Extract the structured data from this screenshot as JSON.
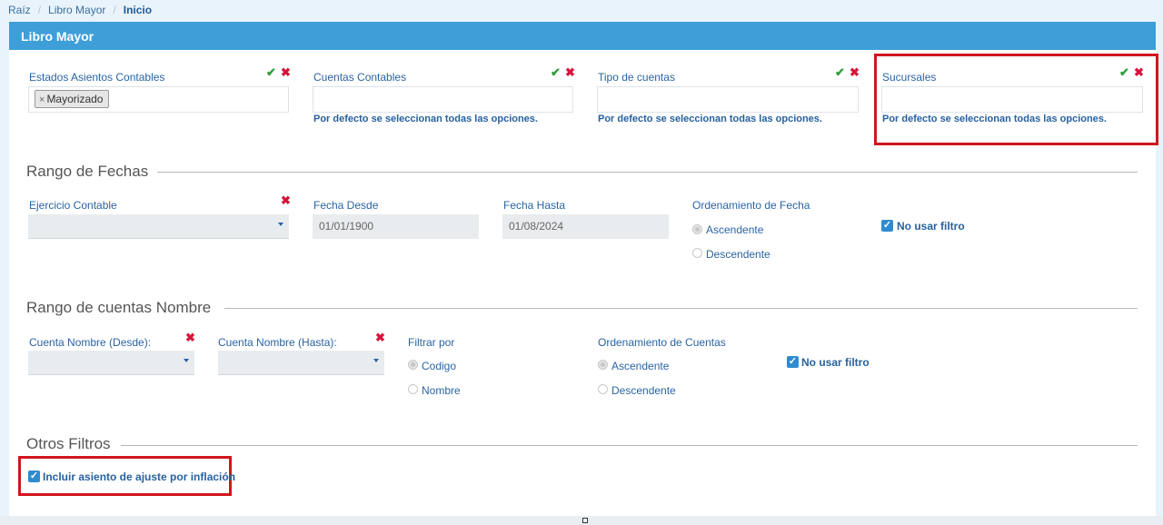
{
  "breadcrumb": {
    "items": [
      "Raíz",
      "Libro Mayor",
      "Inicio"
    ]
  },
  "panel": {
    "title": "Libro Mayor"
  },
  "filters": {
    "estados": {
      "label": "Estados Asientos Contables",
      "tag": "Mayorizado",
      "tag_remove": "×"
    },
    "cuentas": {
      "label": "Cuentas Contables",
      "hint": "Por defecto se seleccionan todas las opciones."
    },
    "tipo": {
      "label": "Tipo de cuentas",
      "hint": "Por defecto se seleccionan todas las opciones."
    },
    "sucursales": {
      "label": "Sucursales",
      "hint": "Por defecto se seleccionan todas las opciones."
    }
  },
  "icons": {
    "check": "✔",
    "close": "✖"
  },
  "fechas": {
    "title": "Rango de Fechas",
    "ejercicio_label": "Ejercicio Contable",
    "desde_label": "Fecha Desde",
    "desde_value": "01/01/1900",
    "hasta_label": "Fecha Hasta",
    "hasta_value": "01/08/2024",
    "orden_label": "Ordenamiento de Fecha",
    "asc": "Ascendente",
    "desc": "Descendente",
    "no_filtro": "No usar filtro"
  },
  "cuentas_nombre": {
    "title": "Rango de cuentas Nombre",
    "desde_label": "Cuenta Nombre (Desde):",
    "hasta_label": "Cuenta Nombre (Hasta):",
    "filtrar_label": "Filtrar por",
    "codigo": "Codigo",
    "nombre": "Nombre",
    "orden_label": "Ordenamiento de Cuentas",
    "asc": "Ascendente",
    "desc": "Descendente",
    "no_filtro": "No usar filtro"
  },
  "otros": {
    "title": "Otros Filtros",
    "ajuste": "Incluir asiento de ajuste por inflación"
  },
  "colors": {
    "header": "#3e9fd8",
    "accent": "#2f8bd0",
    "highlight": "#d0161d",
    "check": "#2f9e3c",
    "remove": "#d6143c"
  }
}
